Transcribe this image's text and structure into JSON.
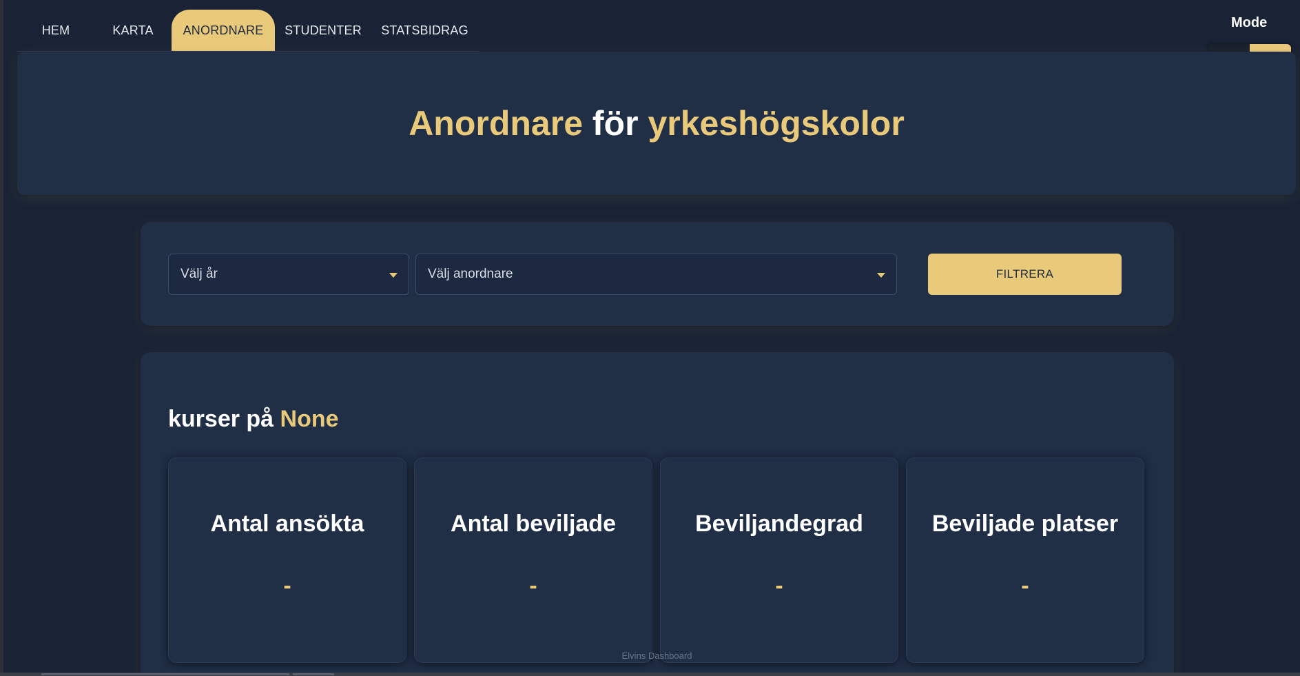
{
  "nav": {
    "tabs": [
      {
        "label": "HEM"
      },
      {
        "label": "KARTA"
      },
      {
        "label": "ANORDNARE"
      },
      {
        "label": "STUDENTER"
      },
      {
        "label": "STATSBIDRAG"
      }
    ],
    "active_tab": "ANORDNARE"
  },
  "mode": {
    "label": "Mode",
    "light_icon": "sun-icon",
    "dark_icon": "moon-icon",
    "selected": "dark"
  },
  "hero": {
    "title_part1": "Anordnare",
    "title_part2": " för ",
    "title_part3": "yrkeshögskolor"
  },
  "filters": {
    "year_placeholder": "Välj år",
    "org_placeholder": "Välj anordnare",
    "button_label": "FILTRERA"
  },
  "results": {
    "title_prefix": "kurser på ",
    "title_value": "None",
    "kpis": [
      {
        "title": "Antal ansökta",
        "value": "-"
      },
      {
        "title": "Antal beviljade",
        "value": "-"
      },
      {
        "title": "Beviljandegrad",
        "value": "-"
      },
      {
        "title": "Beviljade platser",
        "value": "-"
      }
    ]
  },
  "footer": {
    "text": "Elvins Dashboard"
  },
  "colors": {
    "background": "#192335",
    "card": "#202e46",
    "accent": "#e9c97a",
    "text": "#ffffff"
  }
}
